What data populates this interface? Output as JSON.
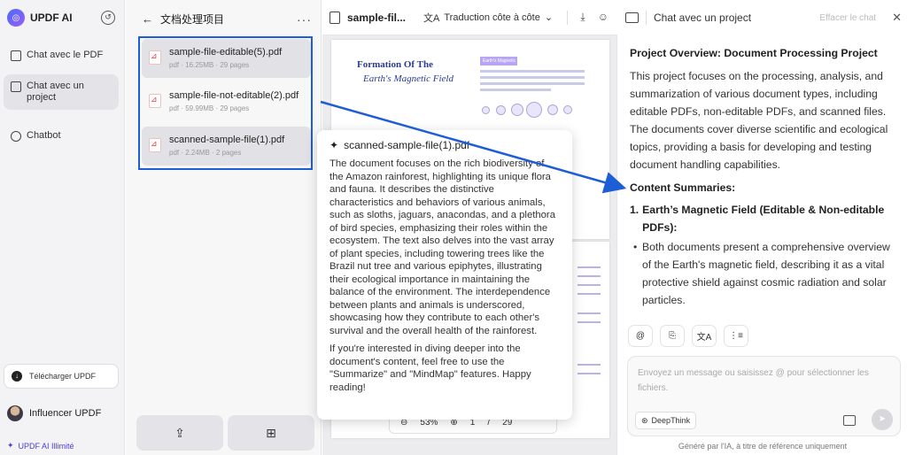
{
  "sidebar": {
    "brand": "UPDF AI",
    "nav": [
      {
        "label": "Chat avec le PDF"
      },
      {
        "label": "Chat avec un project"
      },
      {
        "label": "Chatbot"
      }
    ],
    "download_label": "Télécharger UPDF",
    "user_name": "Influencer UPDF",
    "plan_label": "UPDF AI Illimité"
  },
  "project": {
    "title": "文档处理项目",
    "files": [
      {
        "name": "sample-file-editable(5).pdf",
        "meta": "pdf · 16.25MB · 29 pages"
      },
      {
        "name": "sample-file-not-editable(2).pdf",
        "meta": "pdf · 59.99MB · 29 pages"
      },
      {
        "name": "scanned-sample-file(1).pdf",
        "meta": "pdf · 2.24MB · 2 pages"
      }
    ]
  },
  "viewer": {
    "file_title": "sample-fil...",
    "translate_label": "Traduction côte à côte",
    "page_title": "Formation Of The",
    "page_subtitle": "Earth's Magnetic Field",
    "page_tag": "Earth's Magnetic",
    "zoom": "53%",
    "page_current": "1",
    "page_total": "29"
  },
  "tooltip": {
    "title": "scanned-sample-file(1).pdf",
    "paragraph1": "The document focuses on the rich biodiversity of the Amazon rainforest, highlighting its unique flora and fauna. It describes the distinctive characteristics and behaviors of various animals, such as sloths, jaguars, anacondas, and a plethora of bird species, emphasizing their roles within the ecosystem. The text also delves into the vast array of plant species, including towering trees like the Brazil nut tree and various epiphytes, illustrating their ecological importance in maintaining the balance of the environment. The interdependence between plants and animals is underscored, showcasing how they contribute to each other's survival and the overall health of the rainforest.",
    "paragraph2": "If you're interested in diving deeper into the document's content, feel free to use the \"Summarize\" and \"MindMap\" features. Happy reading!"
  },
  "chat": {
    "title": "Chat avec un project",
    "clear_label": "Effacer le chat",
    "heading": "Project Overview: Document Processing Project",
    "intro": "This project focuses on the processing, analysis, and summarization of various document types, including editable PDFs, non-editable PDFs, and scanned files. The documents cover diverse scientific and ecological topics, providing a basis for developing and testing document handling capabilities.",
    "section": "Content Summaries:",
    "item_number": "1.",
    "item_title": "Earth’s Magnetic Field (Editable & Non-editable PDFs):",
    "bullet": "Both documents present a comprehensive overview of the Earth's magnetic field, describing it as a vital protective shield against cosmic radiation and solar particles.",
    "input_placeholder": "Envoyez un message ou saisissez @ pour sélectionner les fichiers.",
    "deepthink_label": "DeepThink",
    "footnote": "Généré par l'IA, à titre de référence uniquement"
  },
  "colors": {
    "highlight_border": "#1d5dd6",
    "arrow": "#1d5dd6",
    "brand": "#4a3fd0"
  }
}
